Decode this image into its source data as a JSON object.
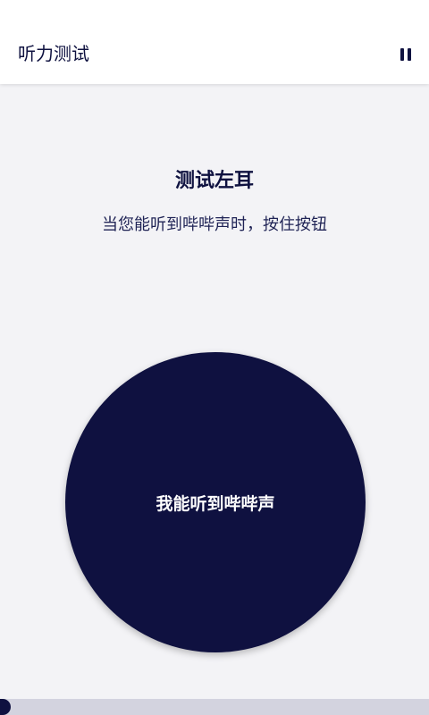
{
  "app_bar": {
    "title": "听力测试",
    "pause_icon": "pause-icon"
  },
  "test": {
    "heading": "测试左耳",
    "instruction": "当您能听到哔哔声时，按住按钮",
    "button_label": "我能听到哔哔声"
  },
  "progress": {
    "percent": 2.5
  },
  "colors": {
    "primary": "#0f1140",
    "background": "#f3f3f6",
    "track": "#d3d3df"
  }
}
